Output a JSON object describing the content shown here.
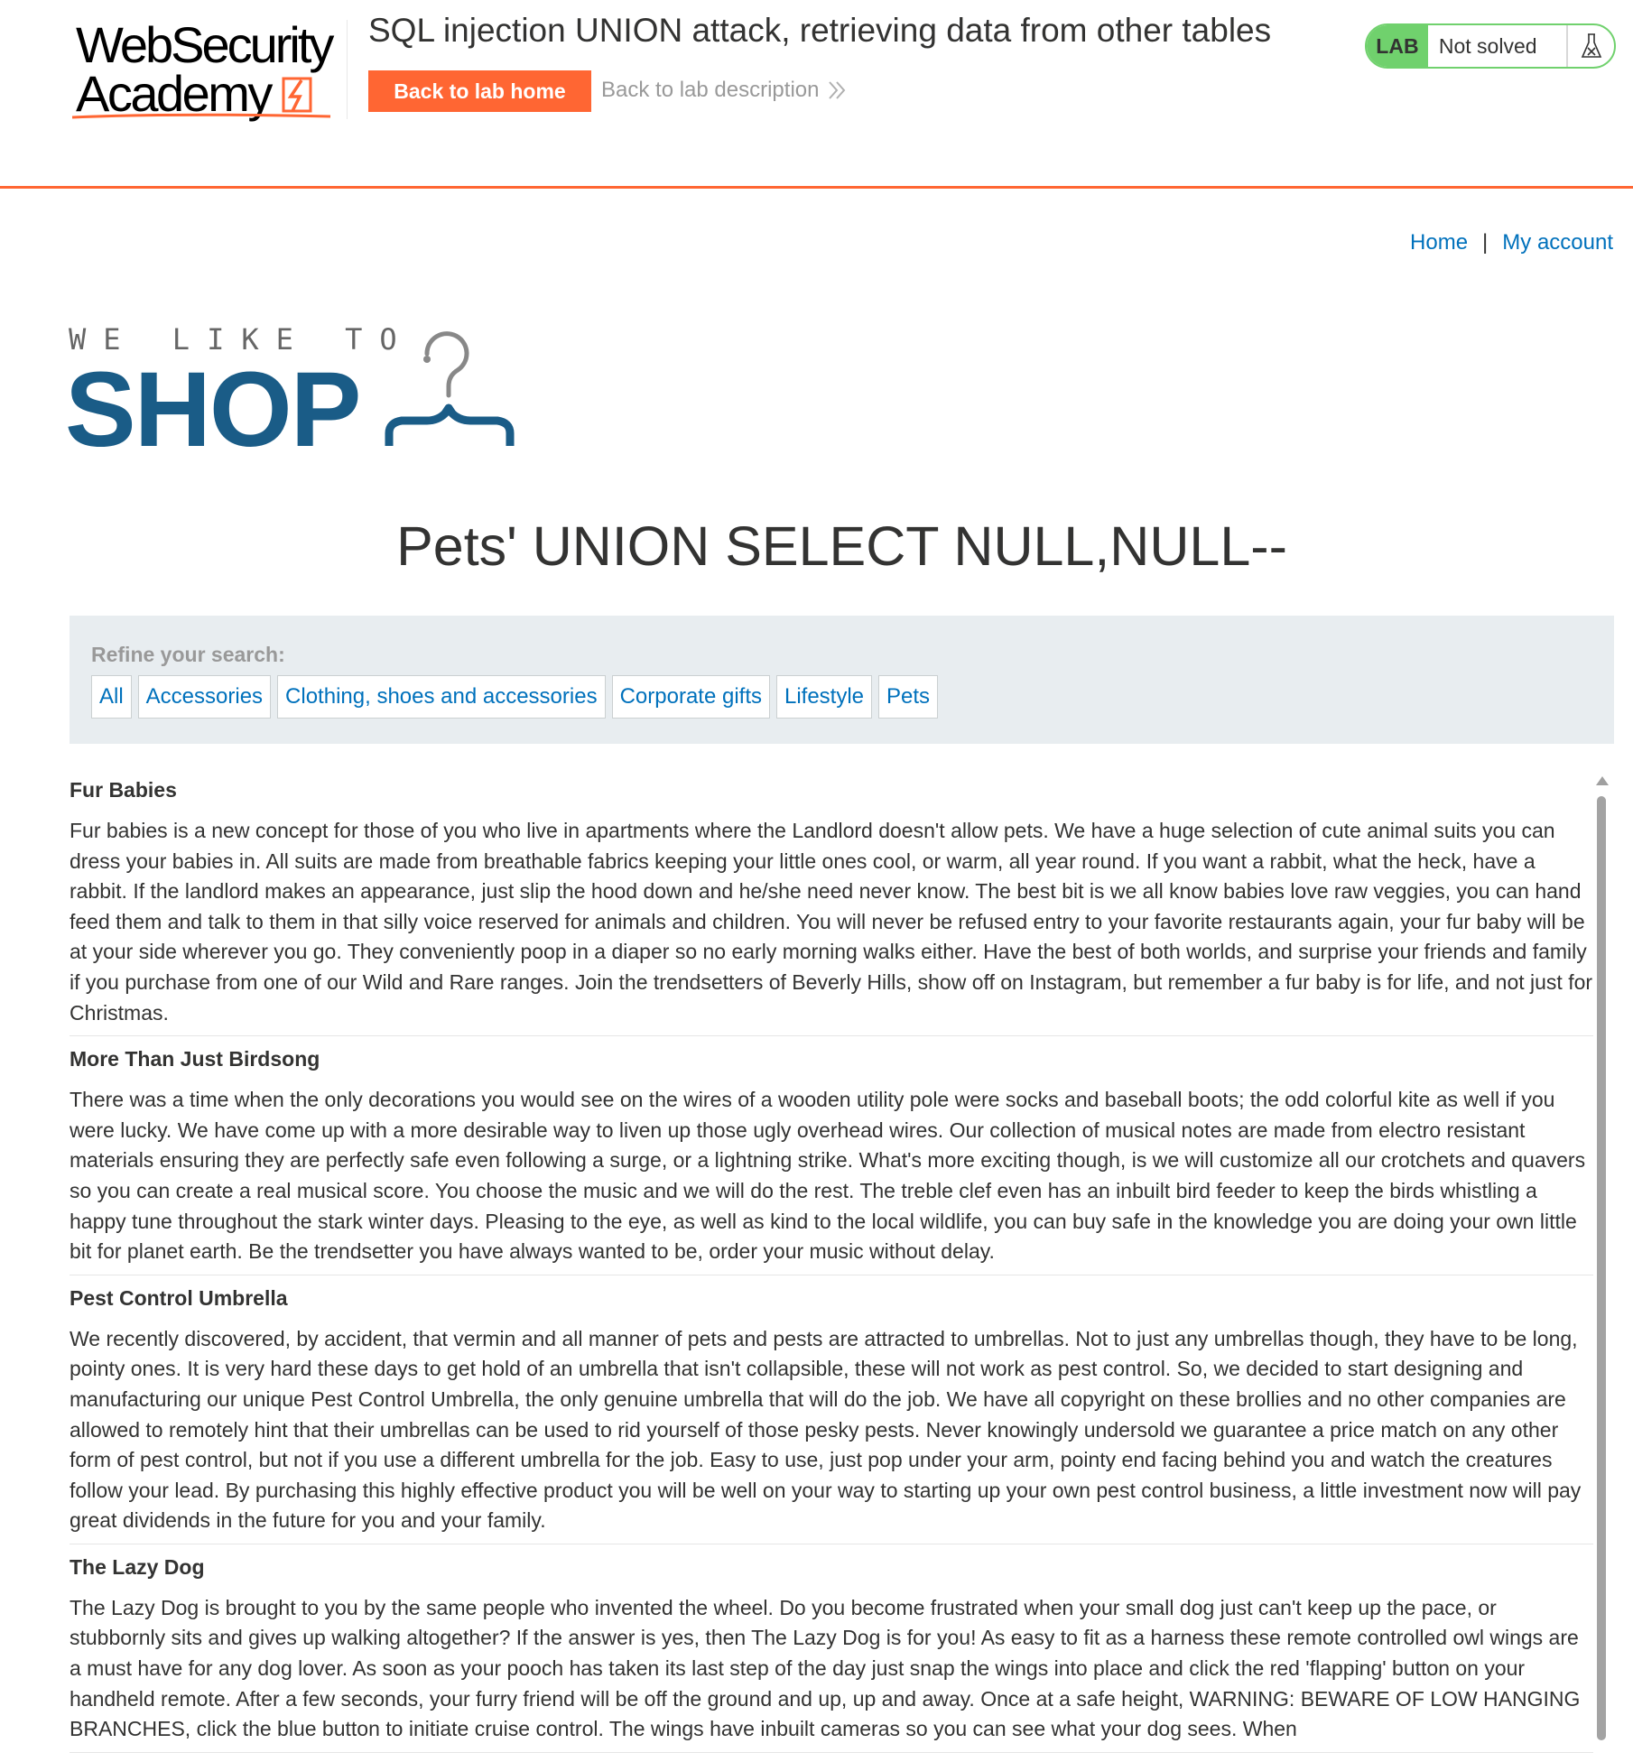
{
  "header": {
    "logo_line1": "WebSecurity",
    "logo_line2": "Academy",
    "lab_title": "SQL injection UNION attack, retrieving data from other tables",
    "back_home_label": "Back to lab home",
    "back_desc_label": "Back to lab description",
    "lab_badge": "LAB",
    "lab_status": "Not solved",
    "accent_color": "#ff6633",
    "status_color": "#70d16d"
  },
  "nav": {
    "home": "Home",
    "separator": "|",
    "account": "My account"
  },
  "shop_logo": {
    "tagline": "WE LIKE TO",
    "word": "SHOP",
    "brand_color": "#1a5c87",
    "icon": "hanger-icon"
  },
  "search_heading": "Pets' UNION SELECT NULL,NULL--",
  "filters": {
    "title": "Refine your search:",
    "items": [
      "All",
      "Accessories",
      "Clothing, shoes and accessories",
      "Corporate gifts",
      "Lifestyle",
      "Pets"
    ]
  },
  "products": [
    {
      "name": "Fur Babies",
      "description": "Fur babies is a new concept for those of you who live in apartments where the Landlord doesn't allow pets. We have a huge selection of cute animal suits you can dress your babies in. All suits are made from breathable fabrics keeping your little ones cool, or warm, all year round. If you want a rabbit, what the heck, have a rabbit. If the landlord makes an appearance, just slip the hood down and he/she need never know. The best bit is we all know babies love raw veggies, you can hand feed them and talk to them in that silly voice reserved for animals and children. You will never be refused entry to your favorite restaurants again, your fur baby will be at your side wherever you go. They conveniently poop in a diaper so no early morning walks either. Have the best of both worlds, and surprise your friends and family if you purchase from one of our Wild and Rare ranges. Join the trendsetters of Beverly Hills, show off on Instagram, but remember a fur baby is for life, and not just for Christmas."
    },
    {
      "name": "More Than Just Birdsong",
      "description": "There was a time when the only decorations you would see on the wires of a wooden utility pole were socks and baseball boots; the odd colorful kite as well if you were lucky. We have come up with a more desirable way to liven up those ugly overhead wires. Our collection of musical notes are made from electro resistant materials ensuring they are perfectly safe even following a surge, or a lightning strike. What's more exciting though, is we will customize all our crotchets and quavers so you can create a real musical score. You choose the music and we will do the rest. The treble clef even has an inbuilt bird feeder to keep the birds whistling a happy tune throughout the stark winter days. Pleasing to the eye, as well as kind to the local wildlife, you can buy safe in the knowledge you are doing your own little bit for planet earth. Be the trendsetter you have always wanted to be, order your music without delay."
    },
    {
      "name": "Pest Control Umbrella",
      "description": "We recently discovered, by accident, that vermin and all manner of pets and pests are attracted to umbrellas. Not to just any umbrellas though, they have to be long, pointy ones. It is very hard these days to get hold of an umbrella that isn't collapsible, these will not work as pest control. So, we decided to start designing and manufacturing our unique Pest Control Umbrella, the only genuine umbrella that will do the job. We have all copyright on these brollies and no other companies are allowed to remotely hint that their umbrellas can be used to rid yourself of those pesky pests. Never knowingly undersold we guarantee a price match on any other form of pest control, but not if you use a different umbrella for the job. Easy to use, just pop under your arm, pointy end facing behind you and watch the creatures follow your lead. By purchasing this highly effective product you will be well on your way to starting up your own pest control business, a little investment now will pay great dividends in the future for you and your family."
    },
    {
      "name": "The Lazy Dog",
      "description": "The Lazy Dog is brought to you by the same people who invented the wheel. Do you become frustrated when your small dog just can't keep up the pace, or stubbornly sits and gives up walking altogether? If the answer is yes, then The Lazy Dog is for you! As easy to fit as a harness these remote controlled owl wings are a must have for any dog lover. As soon as your pooch has taken its last step of the day just snap the wings into place and click the red 'flapping' button on your handheld remote. After a few seconds, your furry friend will be off the ground and up, up and away. Once at a safe height, WARNING: BEWARE OF LOW HANGING BRANCHES, click the blue button to initiate cruise control. The wings have inbuilt cameras so you can see what your dog sees. When"
    }
  ]
}
